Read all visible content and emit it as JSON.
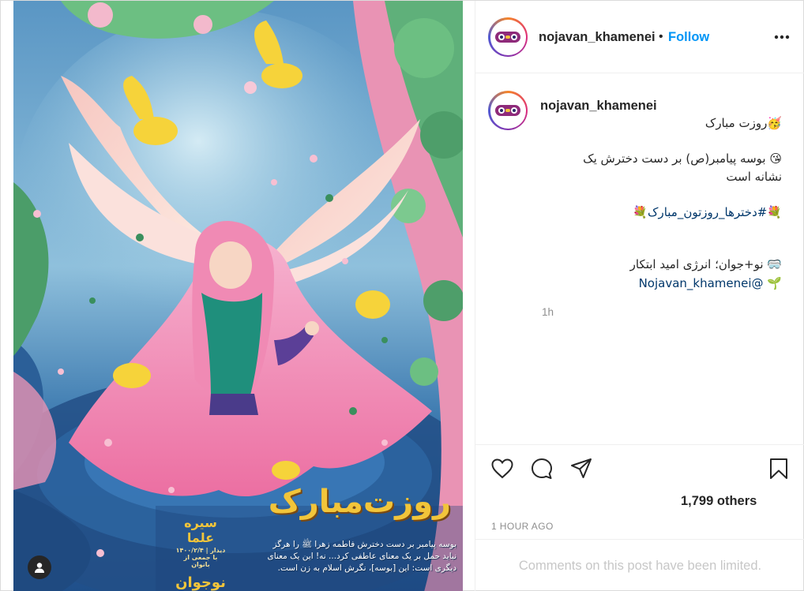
{
  "post": {
    "username": "nojavan_khamenei",
    "separator": "•",
    "follow_label": "Follow",
    "more_icon": "more-horizontal-icon",
    "avatar_text": "نوجوان"
  },
  "artwork": {
    "title": "روزت‌مبارک",
    "caption_lines": [
      "بوسه پیامبر بر دست دخترش فاطمه زهرا ﷺ را هرگز",
      "نباید حمل بر یک معنای عاطفی کرد... نه! این یک معنای",
      "دیگری است: این [بوسه]، نگرش اسلام به زن است."
    ],
    "logo_line1": "سیره علما",
    "logo_line2": "۱۴۰۰/۲/۴ | دیدار با جمعی از بانوان",
    "logo_line3": "نوجوان",
    "tag_icon": "user-tag-icon"
  },
  "caption": {
    "username": "nojavan_khamenei",
    "line1": "🥳روزت مبارک",
    "line2": "😘 بوسه پیامبر(ص) بر دست دخترش یک",
    "line3": "نشانه است",
    "line4": "💐#دخترها_روزتون_مبارک💐",
    "line5": "🥽 نو+جوان؛ انرژی امید ابتکار",
    "line6": "🌱 @Nojavan_khamenei",
    "time": "1h"
  },
  "actions": {
    "like_icon": "heart-icon",
    "comment_icon": "comment-icon",
    "share_icon": "paper-plane-icon",
    "save_icon": "bookmark-icon",
    "likes_text": "1,799 others",
    "post_time": "1 HOUR AGO"
  },
  "comments": {
    "limited_text": "Comments on this post have been limited."
  },
  "colors": {
    "accent": "#0095f6",
    "muted": "#8e8e8e",
    "text": "#262626",
    "art_title": "#f2c53a"
  }
}
